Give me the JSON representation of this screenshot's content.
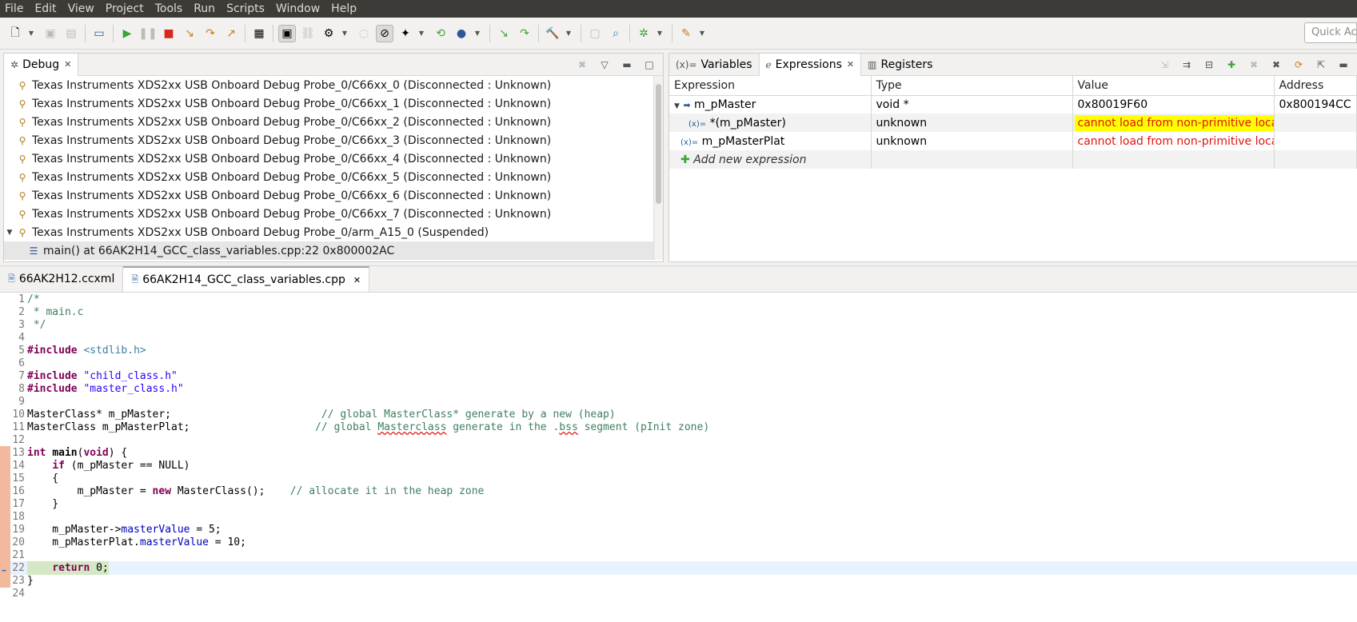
{
  "menu": [
    "File",
    "Edit",
    "View",
    "Project",
    "Tools",
    "Run",
    "Scripts",
    "Window",
    "Help"
  ],
  "toolbar": {
    "quick_access_placeholder": "Quick Access"
  },
  "debug": {
    "tab_label": "Debug",
    "items": [
      "Texas Instruments XDS2xx USB Onboard Debug Probe_0/C66xx_0 (Disconnected : Unknown)",
      "Texas Instruments XDS2xx USB Onboard Debug Probe_0/C66xx_1 (Disconnected : Unknown)",
      "Texas Instruments XDS2xx USB Onboard Debug Probe_0/C66xx_2 (Disconnected : Unknown)",
      "Texas Instruments XDS2xx USB Onboard Debug Probe_0/C66xx_3 (Disconnected : Unknown)",
      "Texas Instruments XDS2xx USB Onboard Debug Probe_0/C66xx_4 (Disconnected : Unknown)",
      "Texas Instruments XDS2xx USB Onboard Debug Probe_0/C66xx_5 (Disconnected : Unknown)",
      "Texas Instruments XDS2xx USB Onboard Debug Probe_0/C66xx_6 (Disconnected : Unknown)",
      "Texas Instruments XDS2xx USB Onboard Debug Probe_0/C66xx_7 (Disconnected : Unknown)",
      "Texas Instruments XDS2xx USB Onboard Debug Probe_0/arm_A15_0 (Suspended)"
    ],
    "frame": "main() at 66AK2H14_GCC_class_variables.cpp:22 0x800002AC"
  },
  "expressions": {
    "tabs": [
      "Variables",
      "Expressions",
      "Registers"
    ],
    "columns": [
      "Expression",
      "Type",
      "Value",
      "Address"
    ],
    "rows": [
      {
        "expression": "m_pMaster",
        "type": "void *",
        "value": "0x80019F60",
        "address": "0x800194CC"
      },
      {
        "expression": "*(m_pMaster)",
        "type": "unknown",
        "value": "cannot load from non-primitive location",
        "address": ""
      },
      {
        "expression": "m_pMasterPlat",
        "type": "unknown",
        "value": "cannot load from non-primitive location",
        "address": ""
      }
    ],
    "add_label": "Add new expression"
  },
  "editor": {
    "tabs": [
      "66AK2H12.ccxml",
      "66AK2H14_GCC_class_variables.cpp"
    ],
    "line_numbers": [
      "1",
      "2",
      "3",
      "4",
      "5",
      "6",
      "7",
      "8",
      "9",
      "10",
      "11",
      "12",
      "13",
      "14",
      "15",
      "16",
      "17",
      "18",
      "19",
      "20",
      "21",
      "22",
      "23",
      "24"
    ]
  }
}
